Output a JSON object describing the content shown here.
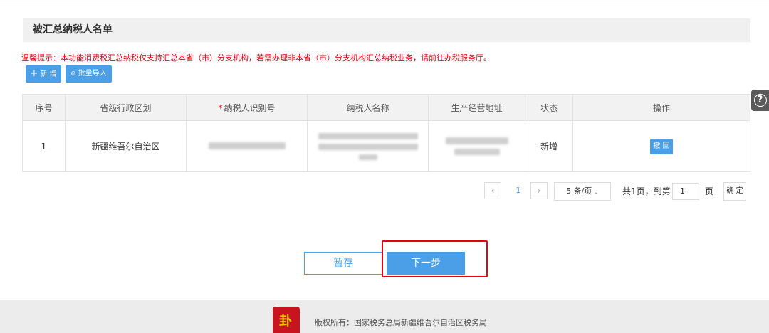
{
  "section": {
    "title": "被汇总纳税人名单"
  },
  "tip": "温馨提示：本功能消费税汇总纳税仅支持汇总本省（市）分支机构，若需办理非本省（市）分支机构汇总纳税业务，请前往办税服务厅。",
  "toolbar": {
    "add_label": "新 增",
    "add_icon": "plus-icon",
    "import_label": "批量导入",
    "import_icon": "upload-circle-icon"
  },
  "help": {
    "icon": "help-icon",
    "glyph": "?"
  },
  "table": {
    "columns": {
      "seq": "序号",
      "region": "省级行政区划",
      "taxpayer_id_required": "*",
      "taxpayer_id": "纳税人识别号",
      "taxpayer_name": "纳税人名称",
      "address": "生产经营地址",
      "status": "状态",
      "action": "操作"
    },
    "rows": [
      {
        "seq": "1",
        "region": "新疆维吾尔自治区",
        "taxpayer_id": "",
        "taxpayer_name": "",
        "address": "",
        "status": "新增",
        "action_label": "撤 回"
      }
    ]
  },
  "pagination": {
    "prev": "‹",
    "current_page": "1",
    "next": "›",
    "page_size": "5 条/页",
    "total_goto": "共1页，到第",
    "goto_value": "1",
    "page_unit": "页",
    "confirm": "确 定"
  },
  "actions": {
    "save": "暂存",
    "next": "下一步"
  },
  "footer": {
    "copyright": "版权所有：国家税务总局新疆维吾尔自治区税务局"
  },
  "colors": {
    "primary": "#4a9fe6",
    "warning": "#e60012",
    "emblem": "#c8141e"
  }
}
